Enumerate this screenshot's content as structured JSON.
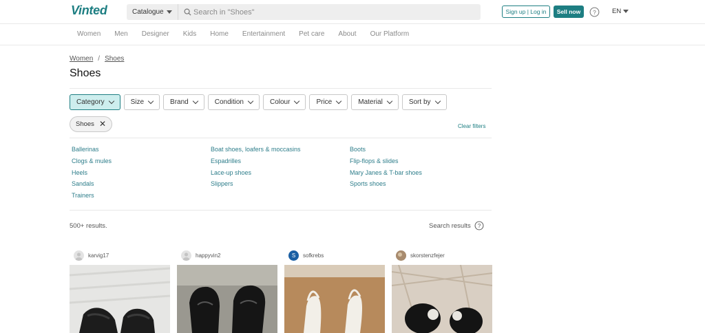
{
  "header": {
    "logo": "Vinted",
    "catalogue_label": "Catalogue",
    "search_placeholder": "Search in \"Shoes\"",
    "signup_label": "Sign up | Log in",
    "sell_label": "Sell now",
    "language": "EN",
    "brand_color": "#1d7e82"
  },
  "nav": {
    "items": [
      "Women",
      "Men",
      "Designer",
      "Kids",
      "Home",
      "Entertainment",
      "Pet care",
      "About",
      "Our Platform"
    ]
  },
  "breadcrumb": [
    "Women",
    "Shoes"
  ],
  "page_title": "Shoes",
  "filters": [
    "Category",
    "Size",
    "Brand",
    "Condition",
    "Colour",
    "Price",
    "Material",
    "Sort by"
  ],
  "active_filter": "Category",
  "active_chip": "Shoes",
  "clear_filters_label": "Clear filters",
  "subcategories": {
    "col1": [
      "Ballerinas",
      "Clogs & mules",
      "Heels",
      "Sandals",
      "Trainers"
    ],
    "col2": [
      "Boat shoes, loafers & moccasins",
      "Espadrilles",
      "Lace-up shoes",
      "Slippers"
    ],
    "col3": [
      "Boots",
      "Flip-flops & slides",
      "Mary Janes & T-bar shoes",
      "Sports shoes"
    ]
  },
  "results": {
    "count_label": "500+ results.",
    "search_results_label": "Search results"
  },
  "products": [
    {
      "username": "karvig17",
      "avatar": "default-avatar-icon"
    },
    {
      "username": "happyvin2",
      "avatar": "default-avatar-icon"
    },
    {
      "username": "sofkrebs",
      "avatar_letter": "S"
    },
    {
      "username": "skorstenzfejer",
      "avatar": "photo-avatar"
    }
  ]
}
